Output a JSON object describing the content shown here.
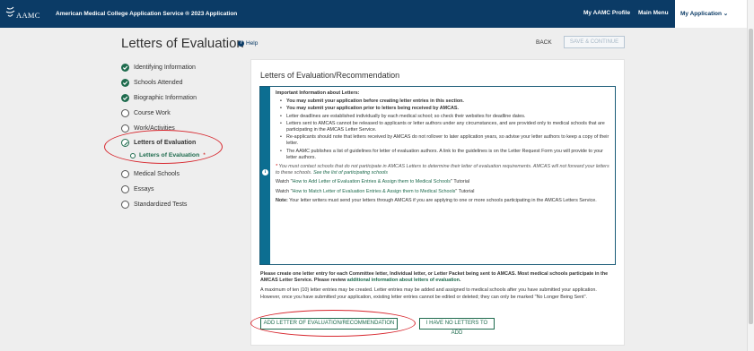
{
  "header": {
    "logo_text": "AAMC",
    "app_title": "American Medical College Application Service ® 2023 Application",
    "nav": [
      "My AAMC Profile",
      "Main Menu"
    ],
    "active_nav": "My Application ⌄"
  },
  "page": {
    "title": "Letters of Evaluation",
    "help": "Help",
    "back": "BACK",
    "save": "SAVE & CONTINUE"
  },
  "sidebar": {
    "items": [
      {
        "label": "Identifying Information",
        "state": "complete"
      },
      {
        "label": "Schools Attended",
        "state": "complete"
      },
      {
        "label": "Biographic Information",
        "state": "complete"
      },
      {
        "label": "Course Work",
        "state": "empty"
      },
      {
        "label": "Work/Activities",
        "state": "empty"
      },
      {
        "label": "Letters of Evaluation",
        "state": "current"
      },
      {
        "label": "Medical Schools",
        "state": "empty"
      },
      {
        "label": "Essays",
        "state": "empty"
      },
      {
        "label": "Standardized Tests",
        "state": "empty"
      }
    ],
    "sub_item": {
      "label": "Letters of Evaluation",
      "marker": "*"
    }
  },
  "main": {
    "title": "Letters of Evaluation/Recommendation",
    "info": {
      "heading": "Important Information about Letters:",
      "bullets": [
        "You may submit your application before creating letter entries in this section.",
        "You may submit your application prior to letters being received by AMCAS.",
        "Letter deadlines are established individually by each medical school; so check their websites for deadline dates.",
        "Letters sent to AMCAS cannot be released to applicants or letter authors under any circumstances, and are provided only to medical schools that are participating in the AMCAS Letter Service.",
        "Re-applicants should note that letters received by AMCAS do not rollover to later application years, so advise your letter authors to keep a copy of their letter.",
        "The AAMC publishes a list of guidelines for letter of evaluation authors. A link to the guidelines is on the Letter Request Form you will provide to your letter authors."
      ],
      "note_marker": "*",
      "note_text": " You must contact schools that do not participate in AMCAS Letters to determine their letter of evaluation requirements. AMCAS will not forward your letters to these schools. ",
      "note_link": "See the list of participating schools",
      "watch1_prefix": "Watch \"",
      "watch1_link": "How to Add Letter of Evaluation Entries & Assign them to Medical Schools",
      "watch1_suffix": "\" Tutorial",
      "watch2_prefix": "Watch \"",
      "watch2_link": "How to Match Letter of Evaluation Entries & Assign them to Medical Schools",
      "watch2_suffix": "\" Tutorial",
      "note2_label": "Note:",
      "note2_text": " Your letter writers must send your letters through AMCAS if you are applying to one or more schools participating in the AMCAS Letters Service."
    },
    "create_bold": "Please create one letter entry for each Committee letter, Individual letter, or Letter Packet being sent to AMCAS. Most medical schools participate in the AMCAS Letter Service. Please review ",
    "create_link": "additional information about letters of evaluation",
    "create_bold_end": ".",
    "create_text": "A maximum of ten (10) letter entries may be created. Letter entries may be added and assigned to medical schools after you have submitted your application. However, once you have submitted your application, existing letter entries cannot be edited or deleted; they can only be marked \"No Longer Being Sent\".",
    "add_button": "ADD LETTER OF EVALUATION/RECOMMENDATION",
    "none_button": "I HAVE NO LETTERS TO ADD"
  },
  "colors": {
    "navy": "#0b3b66",
    "green": "#1e6b4d",
    "info_bar": "#0c6e91",
    "annotation": "#d7262d"
  }
}
